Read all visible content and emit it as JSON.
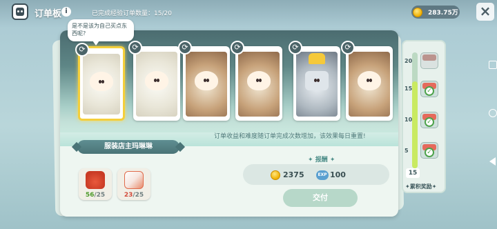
{
  "header": {
    "title": "订单板",
    "progress": "已完成经验订单数量：15/20",
    "coins": "283.75万"
  },
  "orders": [
    {
      "style": "white",
      "selected": true
    },
    {
      "style": "white",
      "selected": false
    },
    {
      "style": "brown",
      "selected": false
    },
    {
      "style": "brown",
      "selected": false
    },
    {
      "style": "robot",
      "selected": false
    },
    {
      "style": "brown",
      "selected": false
    }
  ],
  "bubble": "是不是该为自己买点东西呢?",
  "notice": "订单收益和难度随订单完成次数增加，该效果每日重置!",
  "customer": "服装店主玛琳琳",
  "requirements": [
    {
      "item": "jar",
      "have": "56",
      "need": "25",
      "enough": true
    },
    {
      "item": "box",
      "have": "23",
      "need": "25",
      "enough": false
    }
  ],
  "reward": {
    "label": "报酬",
    "coins": "2375",
    "exp_label": "EXP",
    "exp": "100"
  },
  "submit_label": "交付",
  "rail": {
    "ticks": [
      "20",
      "15",
      "10",
      "5"
    ],
    "current": "15",
    "progress_fraction": 0.75,
    "caption": "累积奖励",
    "chests": [
      {
        "level": "20",
        "claimed": false
      },
      {
        "level": "15",
        "claimed": true
      },
      {
        "level": "10",
        "claimed": true
      },
      {
        "level": "5",
        "claimed": true
      }
    ]
  },
  "icons": {
    "app": "order-board-icon",
    "info": "info-icon",
    "coin": "coin-icon",
    "close": "close-icon",
    "refresh": "refresh-icon",
    "exp": "exp-icon",
    "chest": "chest-icon",
    "check": "check-icon"
  },
  "colors": {
    "selected_border": "#f4cf3b",
    "enough": "#4c9a2a",
    "lacking": "#d24a3a",
    "rail_fill": "#c9ea62"
  }
}
